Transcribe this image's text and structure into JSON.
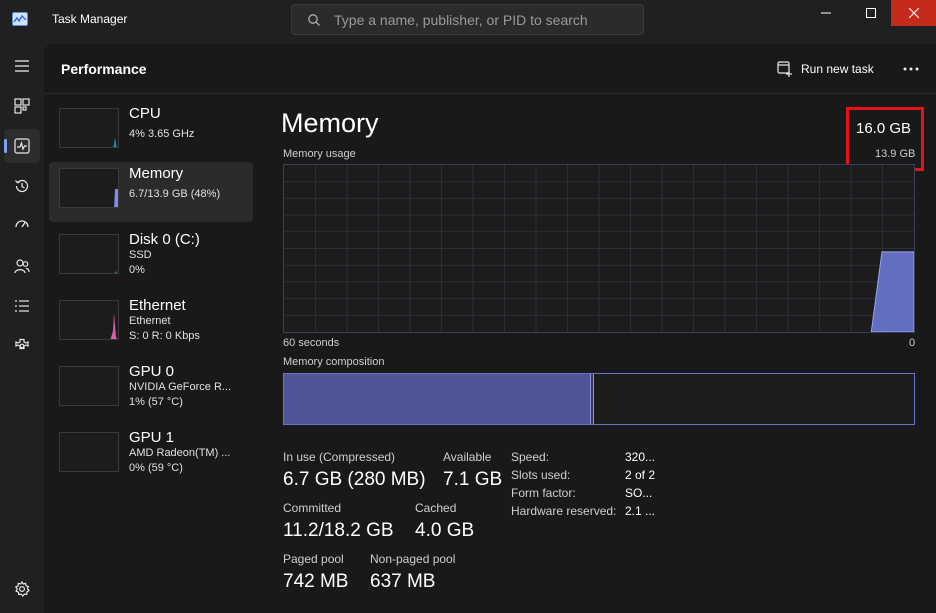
{
  "app": {
    "title": "Task Manager"
  },
  "search": {
    "placeholder": "Type a name, publisher, or PID to search"
  },
  "header": {
    "title": "Performance",
    "run_task_label": "Run new task"
  },
  "nav": {
    "items": [
      {
        "name": "hamburger-menu",
        "icon": "menu-icon"
      },
      {
        "name": "processes",
        "icon": "processes-icon"
      },
      {
        "name": "performance",
        "icon": "performance-icon",
        "active": true
      },
      {
        "name": "app-history",
        "icon": "history-icon"
      },
      {
        "name": "startup-apps",
        "icon": "startup-icon"
      },
      {
        "name": "users",
        "icon": "users-icon"
      },
      {
        "name": "details",
        "icon": "list-icon"
      },
      {
        "name": "services",
        "icon": "services-icon"
      }
    ],
    "settings_icon": "settings-icon"
  },
  "devices": [
    {
      "name": "CPU",
      "line1": "4% 3.65 GHz",
      "line2": "",
      "color": "#17a2b8"
    },
    {
      "name": "Memory",
      "line1": "6.7/13.9 GB (48%)",
      "line2": "",
      "color": "#7f8ce8",
      "active": true
    },
    {
      "name": "Disk 0 (C:)",
      "line1": "SSD",
      "line2": "0%",
      "color": "#1aa88a"
    },
    {
      "name": "Ethernet",
      "line1": "Ethernet",
      "line2": "S: 0 R: 0 Kbps",
      "color": "#d85ca8"
    },
    {
      "name": "GPU 0",
      "line1": "NVIDIA GeForce R...",
      "line2": "1% (57 °C)",
      "color": "#2aa7b9"
    },
    {
      "name": "GPU 1",
      "line1": "AMD Radeon(TM) ...",
      "line2": "0% (59 °C)",
      "color": "#2aa7b9"
    }
  ],
  "detail": {
    "title": "Memory",
    "total": "16.0 GB",
    "usable": "13.9 GB",
    "usage_label": "Memory usage",
    "axis_left": "60 seconds",
    "axis_right": "0",
    "composition_label": "Memory composition",
    "composition": {
      "in_use_fraction": 0.487,
      "modified_fraction": 0.005
    },
    "usage_series_fraction": [
      0,
      0,
      0,
      0,
      0,
      0,
      0,
      0,
      0,
      0,
      0,
      0,
      0,
      0,
      0,
      0,
      0,
      0,
      0,
      0,
      0,
      0,
      0,
      0,
      0,
      0,
      0,
      0,
      0,
      0,
      0,
      0,
      0,
      0,
      0,
      0,
      0,
      0,
      0,
      0,
      0,
      0,
      0,
      0,
      0,
      0,
      0,
      0,
      0,
      0,
      0,
      0,
      0,
      0,
      0,
      0,
      0.48,
      0.48,
      0.48,
      0.48
    ],
    "stats": [
      {
        "label": "In use (Compressed)",
        "value": "6.7 GB (280 MB)"
      },
      {
        "label": "Available",
        "value": "7.1 GB"
      },
      {
        "label": "Committed",
        "value": "11.2/18.2 GB"
      },
      {
        "label": "Cached",
        "value": "4.0 GB"
      },
      {
        "label": "Paged pool",
        "value": "742 MB"
      },
      {
        "label": "Non-paged pool",
        "value": "637 MB"
      }
    ],
    "properties": [
      {
        "key": "Speed:",
        "value": "320..."
      },
      {
        "key": "Slots used:",
        "value": "2 of 2"
      },
      {
        "key": "Form factor:",
        "value": "SO..."
      },
      {
        "key": "Hardware reserved:",
        "value": "2.1 ..."
      }
    ]
  },
  "colors": {
    "accent": "#7aa7f7",
    "memory": "#7f8ce8",
    "highlight": "#e3131b",
    "close": "#c42b1c"
  }
}
